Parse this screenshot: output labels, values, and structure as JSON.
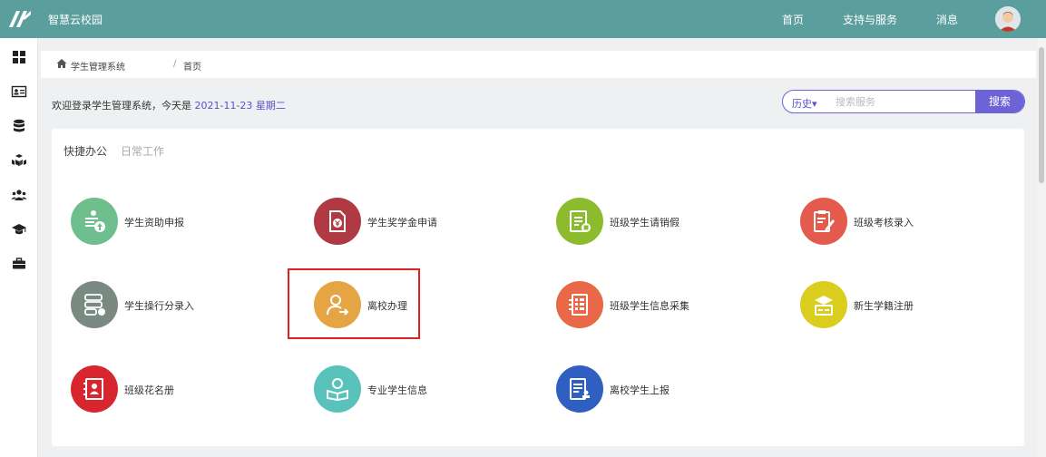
{
  "header": {
    "app_title": "智慧云校园",
    "nav": [
      "首页",
      "支持与服务",
      "消息"
    ],
    "brand_color": "#5a9e9e"
  },
  "sidebar": {
    "icons": [
      "grid-icon",
      "id-card-icon",
      "database-icon",
      "cubes-icon",
      "users-icon",
      "graduation-cap-icon",
      "briefcase-icon"
    ]
  },
  "breadcrumb": {
    "root": "学生管理系统",
    "separator": "/",
    "current": "首页"
  },
  "welcome": {
    "prefix": "欢迎登录学生管理系统，今天是",
    "date": "2021-11-23",
    "weekday": "星期二"
  },
  "search": {
    "history_label": "历史",
    "placeholder": "搜索服务",
    "button_label": "搜索",
    "accent_color": "#6b63d6"
  },
  "tabs": {
    "active": "快捷办公",
    "inactive": "日常工作"
  },
  "tiles": [
    {
      "label": "学生资助申报",
      "color": "#6fbf8e",
      "icon": "aid-upload-icon"
    },
    {
      "label": "学生奖学金申请",
      "color": "#b03a44",
      "icon": "scholarship-icon"
    },
    {
      "label": "班级学生请销假",
      "color": "#8dbb2e",
      "icon": "leave-form-icon"
    },
    {
      "label": "班级考核录入",
      "color": "#e45b4e",
      "icon": "clipboard-edit-icon"
    },
    {
      "label": "学生操行分录入",
      "color": "#7a8a82",
      "icon": "conduct-list-icon"
    },
    {
      "label": "离校办理",
      "color": "#e6a545",
      "icon": "user-leave-icon"
    },
    {
      "label": "班级学生信息采集",
      "color": "#e96848",
      "icon": "info-grid-icon"
    },
    {
      "label": "新生学籍注册",
      "color": "#d9cd1e",
      "icon": "register-icon"
    },
    {
      "label": "班级花名册",
      "color": "#d8262e",
      "icon": "roster-icon"
    },
    {
      "label": "专业学生信息",
      "color": "#59c3bb",
      "icon": "student-reading-icon"
    },
    {
      "label": "离校学生上报",
      "color": "#2f5fc0",
      "icon": "report-stamp-icon"
    }
  ]
}
